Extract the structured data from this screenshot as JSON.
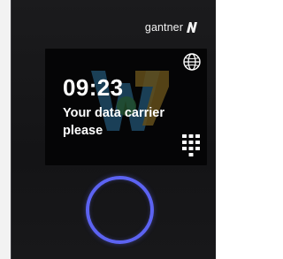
{
  "brand": {
    "name": "gantner",
    "logo_icon": "gantner-n-logo-icon"
  },
  "screen": {
    "time": "09:23",
    "prompt_line1": "Your data carrier",
    "prompt_line2": "please",
    "language_icon": "globe-icon",
    "keypad_icon": "keypad-icon",
    "watermark_icon": "w-watermark-icon"
  },
  "reader": {
    "icon": "rfid-reader-ring",
    "color": "#5c63f2"
  },
  "colors": {
    "device_body": "#18181a",
    "screen_bg": "#050506",
    "text": "#ffffff",
    "accent_ring": "#5c63f2"
  }
}
